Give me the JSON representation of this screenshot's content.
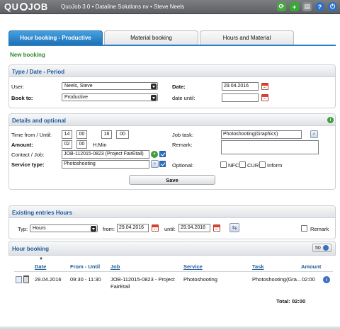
{
  "app": {
    "logo_left": "QU",
    "logo_right": "JOB",
    "title": "QuoJob 3.0 • Dataline Solutions nv • Steve Neels"
  },
  "tabs": [
    {
      "label": "Hour booking - Productive"
    },
    {
      "label": "Material booking"
    },
    {
      "label": "Hours and Material"
    }
  ],
  "new_booking": "New booking",
  "type_date": {
    "header": "Type / Date - Period",
    "user_label": "User:",
    "user_value": "Neels, Steve",
    "book_to_label": "Book to:",
    "book_to_value": "Productive",
    "date_label": "Date:",
    "date_value": "29.04.2016",
    "date_until_label": "date until:",
    "date_until_value": ""
  },
  "details": {
    "header": "Details and optional",
    "time_label": "Time from / Until:",
    "time_from_h": "14",
    "time_from_m": "00",
    "time_until_h": "16",
    "time_until_m": "00",
    "amount_label": "Amount:",
    "amount_h": "02",
    "amount_m": "00",
    "amount_unit": "H:Min",
    "contact_label": "Contact / Job:",
    "contact_value": "JOB-112015-0823 (Project FairEtail)",
    "service_label": "Service type:",
    "service_value": "Photoshooting",
    "job_task_label": "Job task:",
    "job_task_value": "Photoshooting(Graphics)",
    "remark_label": "Remark:",
    "optional_label": "Optional:",
    "nfc_label": "NFC",
    "cur_label": "CUR",
    "inform_label": "Inform",
    "save_label": "Save"
  },
  "existing": {
    "header": "Existing entries Hours",
    "typ_label": "Typ:",
    "typ_value": "Hours",
    "from_label": "from:",
    "from_value": "29.04.2016",
    "until_label": "until:",
    "until_value": "29.04.2016",
    "remark_label": "Remark"
  },
  "hour_booking": {
    "header": "Hour booking",
    "page_size": "50",
    "columns": [
      "Date",
      "From - Until",
      "Job",
      "Service",
      "Task",
      "Amount"
    ],
    "rows": [
      {
        "date": "29.04.2016",
        "from_until": "09:30 - 11:30",
        "job_line1": "JOB-112015-0823 - Project",
        "job_line2": "FairEtail",
        "service": "Photoshooting",
        "task": "Photoshooting(Gra...",
        "amount": "02:00"
      }
    ],
    "total": "Total: 02:00"
  },
  "colors": {
    "accent_blue": "#1e72b8",
    "header_text": "#1d5a9c",
    "new_booking_green": "#2d8a2d"
  }
}
